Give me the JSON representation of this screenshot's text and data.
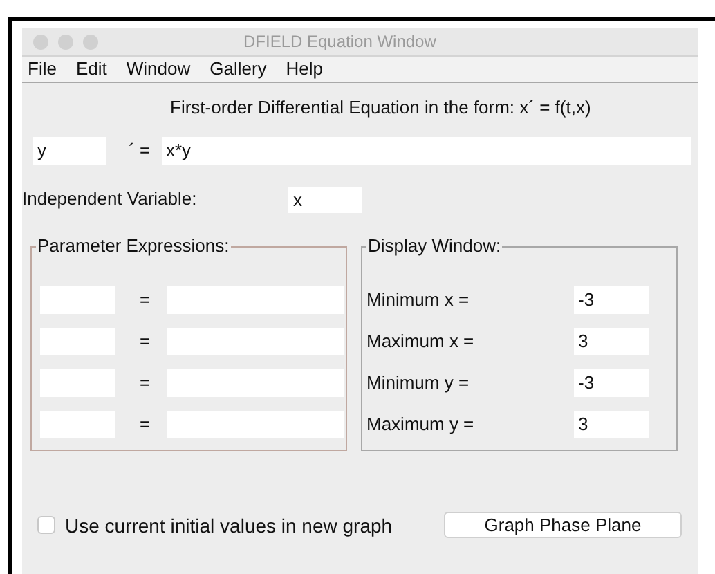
{
  "window": {
    "title": "DFIELD Equation Window"
  },
  "menu": [
    "File",
    "Edit",
    "Window",
    "Gallery",
    "Help"
  ],
  "heading": "First-order Differential Equation in the form: x´ = f(t,x)",
  "equation": {
    "variable": "y",
    "prime_equals": "´ =",
    "expression": "x*y"
  },
  "independent_variable": {
    "label": "Independent Variable:",
    "value": "x"
  },
  "parameters": {
    "title": "Parameter Expressions:",
    "rows": [
      {
        "equals": "="
      },
      {
        "equals": "="
      },
      {
        "equals": "="
      },
      {
        "equals": "="
      }
    ]
  },
  "display_window": {
    "title": "Display Window:",
    "rows": [
      {
        "label": "Minimum x =",
        "value": "-3"
      },
      {
        "label": "Maximum x =",
        "value": "3"
      },
      {
        "label": "Minimum y =",
        "value": "-3"
      },
      {
        "label": "Maximum y =",
        "value": "3"
      }
    ]
  },
  "initial_values": {
    "label": "Use current initial values in new graph",
    "checked": false
  },
  "graph_button": "Graph Phase Plane"
}
